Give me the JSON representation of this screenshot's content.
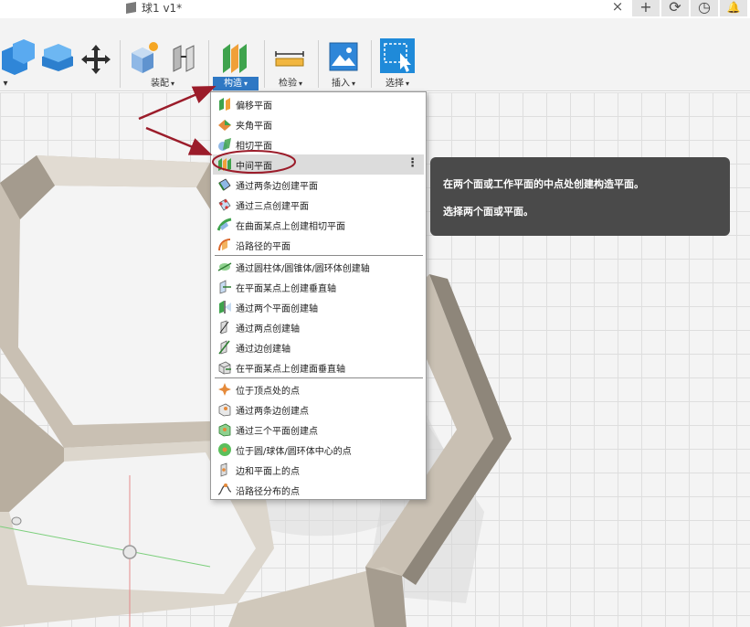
{
  "document": {
    "title": "球1 v1*"
  },
  "toolbar": {
    "groups": [
      {
        "label": "装配"
      },
      {
        "label": "构造"
      },
      {
        "label": "检验"
      },
      {
        "label": "插入"
      },
      {
        "label": "选择"
      }
    ],
    "left_caret": "▾",
    "accent_color": "#2f78c4"
  },
  "construct_menu": {
    "items": [
      {
        "label": "偏移平面"
      },
      {
        "label": "夹角平面"
      },
      {
        "label": "相切平面"
      },
      {
        "label": "中间平面"
      },
      {
        "label": "通过两条边创建平面"
      },
      {
        "label": "通过三点创建平面"
      },
      {
        "label": "在曲面某点上创建相切平面"
      },
      {
        "label": "沿路径的平面"
      },
      {
        "label": "通过圆柱体/圆锥体/圆环体创建轴"
      },
      {
        "label": "在平面某点上创建垂直轴"
      },
      {
        "label": "通过两个平面创建轴"
      },
      {
        "label": "通过两点创建轴"
      },
      {
        "label": "通过边创建轴"
      },
      {
        "label": "在平面某点上创建面垂直轴"
      },
      {
        "label": "位于顶点处的点"
      },
      {
        "label": "通过两条边创建点"
      },
      {
        "label": "通过三个平面创建点"
      },
      {
        "label": "位于圆/球体/圆环体中心的点"
      },
      {
        "label": "边和平面上的点"
      },
      {
        "label": "沿路径分布的点"
      }
    ],
    "highlighted_item": "中间平面",
    "more_icon": "⋮"
  },
  "tooltip": {
    "line1": "在两个面或工作平面的中点处创建构造平面。",
    "line2": "选择两个面或平面。"
  },
  "icons": {
    "tab_close": "×",
    "new_tab": "+",
    "refresh": "⟳",
    "clock": "◷",
    "notification": "🔔"
  },
  "annotation_color": "#9b1c2a"
}
